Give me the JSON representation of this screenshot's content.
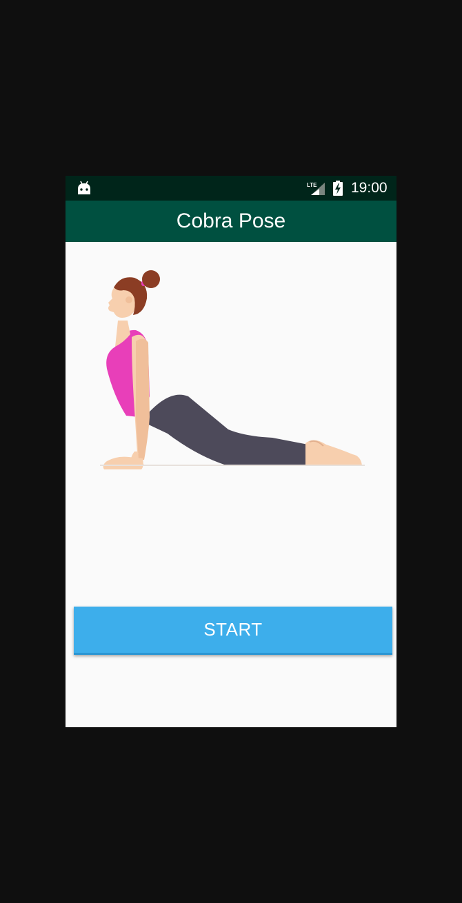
{
  "status_bar": {
    "time": "19:00",
    "network": "LTE",
    "icons": [
      "android-icon",
      "lte-signal-icon",
      "battery-charging-icon"
    ]
  },
  "app_bar": {
    "title": "Cobra Pose"
  },
  "main": {
    "illustration": "cobra-pose-illustration",
    "start_label": "START"
  },
  "colors": {
    "status_bar": "#00251a",
    "app_bar": "#005040",
    "background": "#fafafa",
    "button": "#3daeeb",
    "top": "#e83fb9",
    "pants": "#4d4a5a",
    "hair": "#8b3d24",
    "skin": "#f7cfae"
  }
}
